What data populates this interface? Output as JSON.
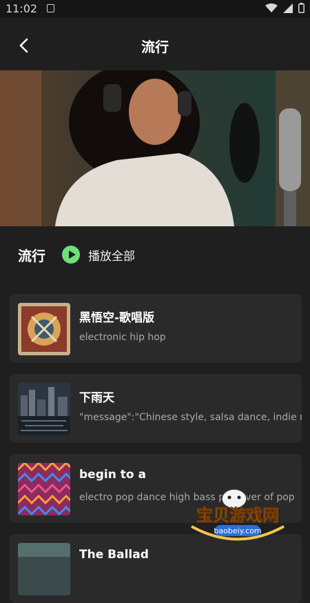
{
  "status_bar": {
    "time": "11:02"
  },
  "header": {
    "title": "流行"
  },
  "section": {
    "title": "流行",
    "play_all_label": "播放全部"
  },
  "songs": [
    {
      "title": "黑悟空-歌唱版",
      "description": "electronic hip hop"
    },
    {
      "title": "下雨天",
      "description": "\"message\":\"Chinese style, salsa dance, indie mu"
    },
    {
      "title": "begin to a",
      "description": " electro pop dance high bass pl... over of pop"
    },
    {
      "title": "The Ballad"
    }
  ],
  "watermark": {
    "brand": "宝贝游戏网",
    "domain": "baobeiy.com"
  },
  "colors": {
    "accent": "#6fe07a",
    "background": "#1f1f1f",
    "card": "#2a2a2a"
  }
}
